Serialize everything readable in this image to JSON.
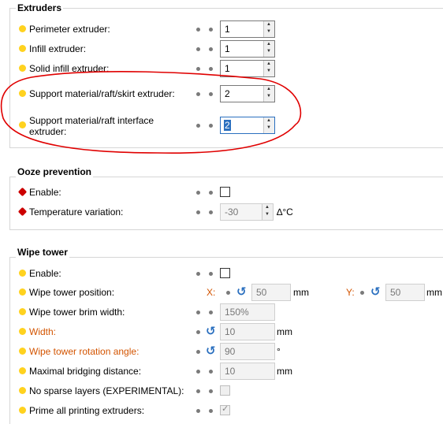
{
  "extruders": {
    "title": "Extruders",
    "perimeter": {
      "label": "Perimeter extruder:",
      "value": "1"
    },
    "infill": {
      "label": "Infill extruder:",
      "value": "1"
    },
    "solid_infill": {
      "label": "Solid infill extruder:",
      "value": "1"
    },
    "support": {
      "label": "Support material/raft/skirt extruder:",
      "value": "2"
    },
    "support_interface": {
      "label": "Support material/raft interface extruder:",
      "value": "2"
    }
  },
  "ooze": {
    "title": "Ooze prevention",
    "enable": {
      "label": "Enable:",
      "checked": false
    },
    "temp_variation": {
      "label": "Temperature variation:",
      "value": "-30",
      "unit": "∆°C"
    }
  },
  "wipe": {
    "title": "Wipe tower",
    "enable": {
      "label": "Enable:",
      "checked": false
    },
    "position": {
      "label": "Wipe tower position:",
      "x_label": "X:",
      "x_value": "50",
      "x_unit": "mm",
      "y_label": "Y:",
      "y_value": "50",
      "y_unit": "mm"
    },
    "brim": {
      "label": "Wipe tower brim width:",
      "value": "150%"
    },
    "width": {
      "label": "Width:",
      "value": "10",
      "unit": "mm"
    },
    "rotation": {
      "label": "Wipe tower rotation angle:",
      "value": "90",
      "unit": "°"
    },
    "bridging": {
      "label": "Maximal bridging distance:",
      "value": "10",
      "unit": "mm"
    },
    "sparse": {
      "label": "No sparse layers (EXPERIMENTAL):",
      "checked": false
    },
    "prime": {
      "label": "Prime all printing extruders:",
      "checked": true
    }
  },
  "icons": {
    "bullet": "yellow-bullet-icon",
    "reset": "undo-arrow-icon",
    "lock": "red-lock-icon"
  },
  "colors": {
    "accent": "#2a6fbf",
    "modified_label": "#d35400",
    "annotation": "#e00000",
    "bullet": "#ffd21f"
  }
}
